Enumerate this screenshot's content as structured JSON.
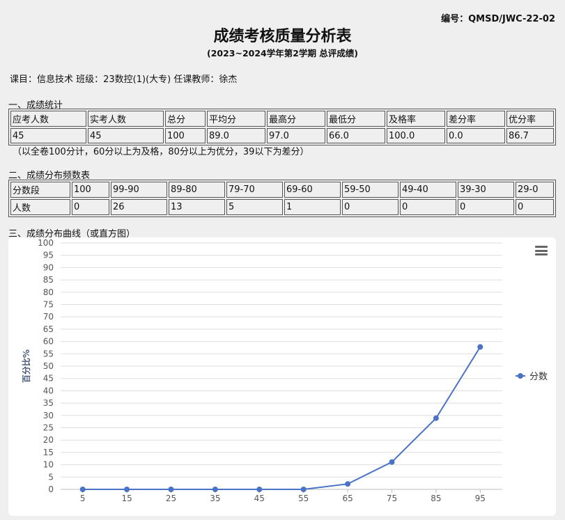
{
  "header": {
    "doc_code": "编号：QMSD/JWC-22-02",
    "title": "成绩考核质量分析表",
    "subtitle": "(2023~2024学年第2学期  总评成绩)"
  },
  "course_info": "课目：信息技术 班级：23数控(1)(大专) 任课教师：徐杰",
  "section1": {
    "title": "一、成绩统计",
    "headers": [
      "应考人数",
      "实考人数",
      "总分",
      "平均分",
      "最高分",
      "最低分",
      "及格率",
      "差分率",
      "优分率"
    ],
    "values": [
      "45",
      "45",
      "100",
      "89.0",
      "97.0",
      "66.0",
      "100.0",
      "0.0",
      "86.7"
    ],
    "note": "（以全卷100分计，60分以上为及格，80分以上为优分，39以下为差分）"
  },
  "section2": {
    "title": "二、成绩分布频数表",
    "row1": [
      "分数段",
      "100",
      "99-90",
      "89-80",
      "79-70",
      "69-60",
      "59-50",
      "49-40",
      "39-30",
      "29-0"
    ],
    "row2": [
      "人数",
      "0",
      "26",
      "13",
      "5",
      "1",
      "0",
      "0",
      "0",
      "0"
    ]
  },
  "section3": {
    "title": "三、成绩分布曲线（或直方图）"
  },
  "chart_data": {
    "type": "line",
    "x": [
      5,
      15,
      25,
      35,
      45,
      55,
      65,
      75,
      85,
      95
    ],
    "series": [
      {
        "name": "分数",
        "values": [
          0,
          0,
          0,
          0,
          0,
          0,
          2.2,
          11.1,
          28.9,
          57.8
        ]
      }
    ],
    "ylabel": "百分比%",
    "xlabel": "",
    "ylim": [
      0,
      100
    ],
    "yticks": [
      0,
      5,
      10,
      15,
      20,
      25,
      30,
      35,
      40,
      45,
      50,
      55,
      60,
      65,
      70,
      75,
      80,
      85,
      90,
      95,
      100
    ],
    "grid": true,
    "legend": "right",
    "color": "#4a72c5"
  }
}
